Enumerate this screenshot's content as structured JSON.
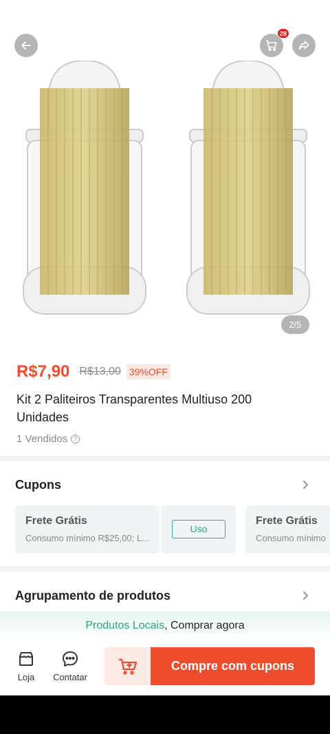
{
  "header": {
    "cart_badge": "28",
    "image_counter": "2/5"
  },
  "product": {
    "price": "R$7,90",
    "original_price": "R$13,00",
    "discount": "39%OFF",
    "title": "Kit 2 Paliteiros Transparentes Multiuso 200 Unidades",
    "sold": "1 Vendidos"
  },
  "coupons": {
    "section_title": "Cupons",
    "items": [
      {
        "title": "Frete Grátis",
        "desc": "Consumo mínimo R$25,00; L...",
        "action": "Uso"
      },
      {
        "title": "Frete Grátis",
        "desc": "Consumo mínimo"
      }
    ]
  },
  "grouping": {
    "section_title": "Agrupamento de produtos"
  },
  "local_strip": {
    "highlight": "Produtos Locais",
    "rest": ", Comprar agora"
  },
  "bottom_bar": {
    "store_label": "Loja",
    "contact_label": "Contatar",
    "buy_label": "Compre com cupons"
  },
  "colors": {
    "accent": "#ee4d2d",
    "green": "#2aa57d",
    "badge": "#e02020"
  },
  "icons": [
    "back-arrow-icon",
    "cart-icon",
    "share-icon",
    "help-icon",
    "chevron-right-icon",
    "store-icon",
    "chat-icon",
    "add-to-cart-icon"
  ]
}
